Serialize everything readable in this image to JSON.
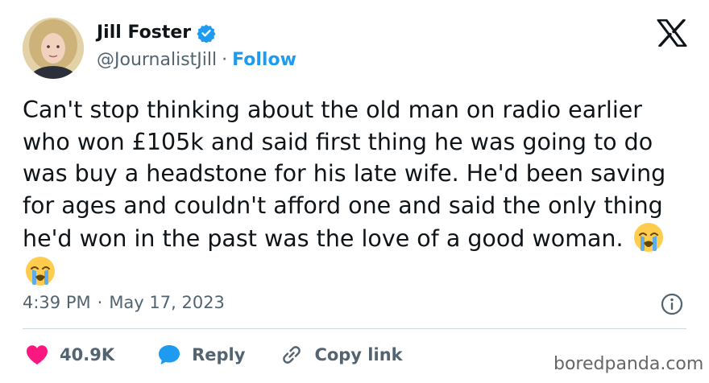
{
  "author": {
    "display_name": "Jill Foster",
    "handle": "@JournalistJill",
    "separator": "·",
    "follow_label": "Follow",
    "verified": true
  },
  "tweet": {
    "text": "Can't stop thinking about the old man on radio earlier who won £105k and said first thing he was going to do was buy a headstone for his late wife. He'd been saving for ages and couldn't afford one and said the only thing he'd won in the past was the love of a good woman.",
    "emojis": [
      "loudly-crying-face",
      "loudly-crying-face"
    ],
    "time": "4:39 PM",
    "date_separator": "·",
    "date": "May 17, 2023"
  },
  "actions": {
    "like_count": "40.9K",
    "reply_label": "Reply",
    "copy_link_label": "Copy link"
  },
  "icons": {
    "brand": "x-logo-icon",
    "verified": "verified-badge-icon",
    "info": "info-icon",
    "like": "heart-icon",
    "reply": "speech-bubble-icon",
    "copy_link": "link-icon"
  },
  "colors": {
    "accent": "#1d9bf0",
    "like": "#f91880",
    "text": "#0f1419",
    "secondary": "#536471"
  },
  "watermark": "boredpanda.com"
}
